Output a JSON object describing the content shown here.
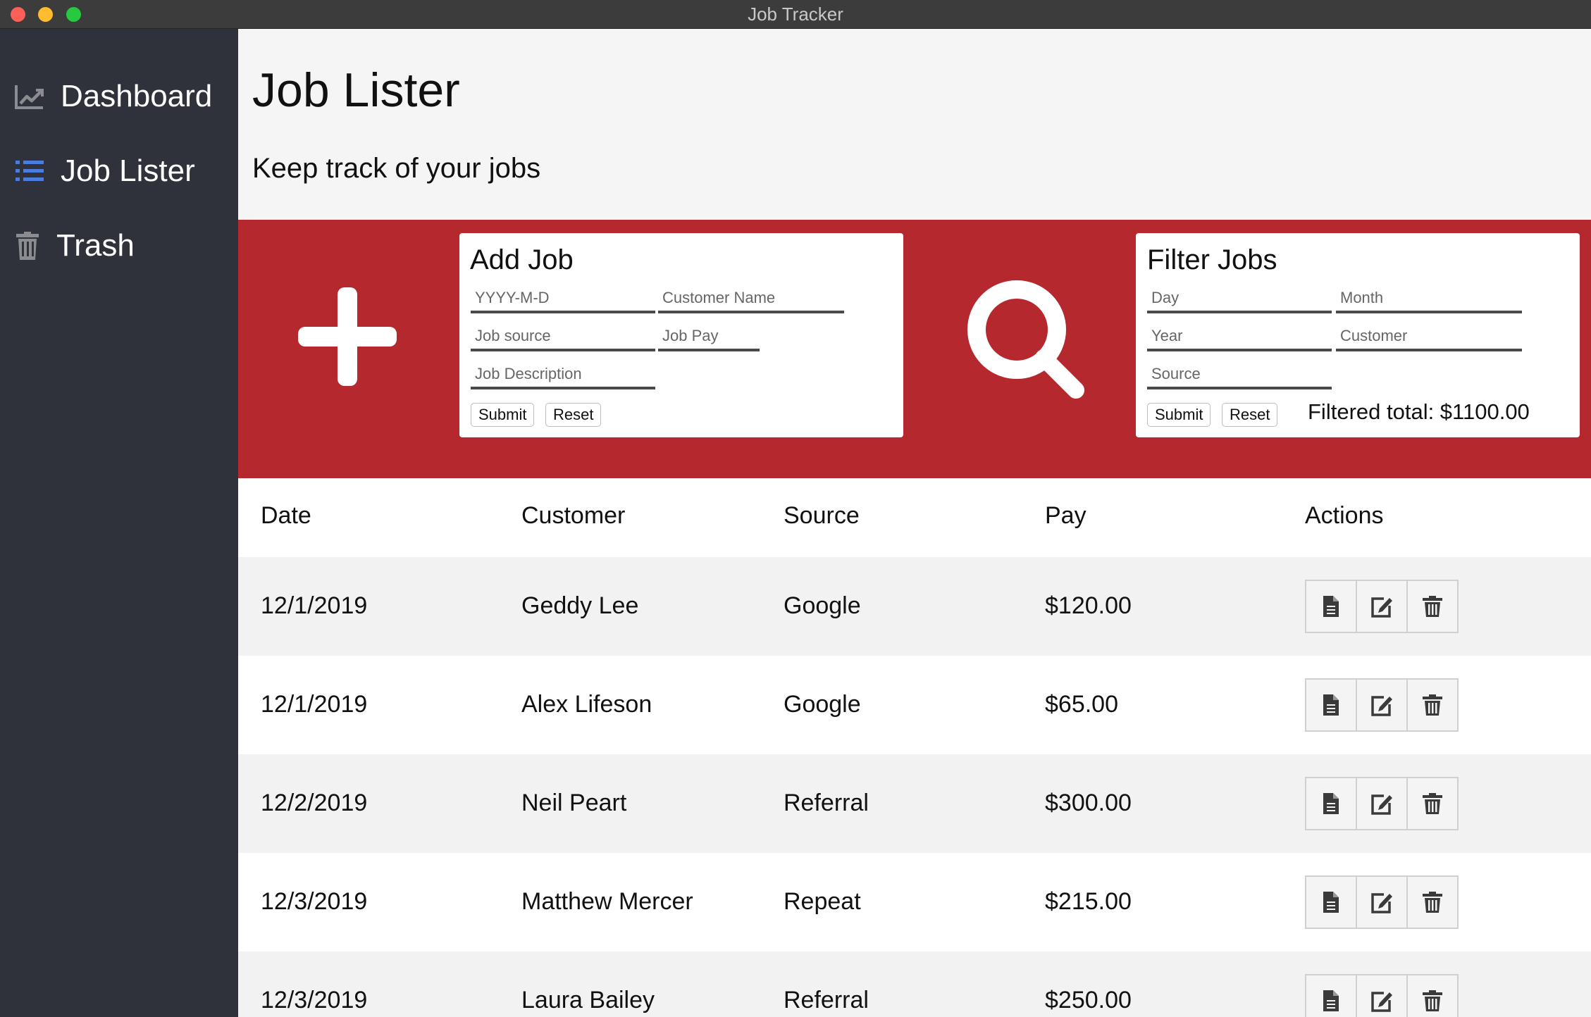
{
  "window": {
    "title": "Job Tracker"
  },
  "sidebar": {
    "items": [
      {
        "label": "Dashboard",
        "icon": "chart-line-icon",
        "active": false
      },
      {
        "label": "Job Lister",
        "icon": "list-icon",
        "active": true
      },
      {
        "label": "Trash",
        "icon": "trash-icon",
        "active": false
      }
    ],
    "active_color": "#4a7de0"
  },
  "main": {
    "title": "Job Lister",
    "subtitle": "Keep track of your jobs"
  },
  "add_job": {
    "title": "Add Job",
    "date_placeholder": "YYYY-M-D",
    "customer_placeholder": "Customer Name",
    "source_placeholder": "Job source",
    "pay_placeholder": "Job Pay",
    "description_placeholder": "Job Description",
    "submit_label": "Submit",
    "reset_label": "Reset"
  },
  "filter_jobs": {
    "title": "Filter Jobs",
    "day_placeholder": "Day",
    "month_placeholder": "Month",
    "year_placeholder": "Year",
    "customer_placeholder": "Customer",
    "source_placeholder": "Source",
    "submit_label": "Submit",
    "reset_label": "Reset",
    "total_text": "Filtered total: $1100.00"
  },
  "colors": {
    "banner": "#b5282e",
    "sidebar": "#30323b"
  },
  "table": {
    "headers": [
      "Date",
      "Customer",
      "Source",
      "Pay",
      "Actions"
    ],
    "rows": [
      {
        "date": "12/1/2019",
        "customer": "Geddy Lee",
        "source": "Google",
        "pay": "$120.00"
      },
      {
        "date": "12/1/2019",
        "customer": "Alex Lifeson",
        "source": "Google",
        "pay": "$65.00"
      },
      {
        "date": "12/2/2019",
        "customer": "Neil Peart",
        "source": "Referral",
        "pay": "$300.00"
      },
      {
        "date": "12/3/2019",
        "customer": "Matthew Mercer",
        "source": "Repeat",
        "pay": "$215.00"
      },
      {
        "date": "12/3/2019",
        "customer": "Laura Bailey",
        "source": "Referral",
        "pay": "$250.00"
      }
    ],
    "action_icons": [
      "document-icon",
      "edit-icon",
      "trash-icon"
    ]
  }
}
